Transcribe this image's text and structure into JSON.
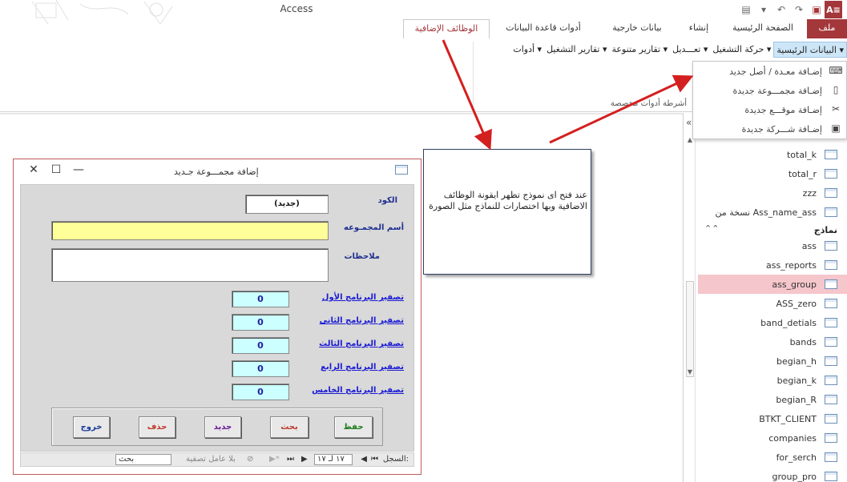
{
  "app": {
    "title": "Access"
  },
  "ribbon_tabs": {
    "file": "ملف",
    "home": "الصفحة الرئيسية",
    "create": "إنشاء",
    "external": "بيانات خارجية",
    "db_tools": "أدوات قاعدة البيانات",
    "addins": "الوظائف الإضافية"
  },
  "menubar": {
    "items": [
      "البيانات الرئيسية",
      "حركة التشغيل",
      "تعـــديل",
      "تقارير متنوعة",
      "تقارير التشغيل",
      "أدوات"
    ],
    "group_label": "أشرطة أدوات مخصصة"
  },
  "dropdown": {
    "items": [
      "إضـافة معـدة / أصل جديد",
      "إضـافة مجمـــوعة جديدة",
      "إضـافة موقـــع جديدة",
      "إضـافة شـــركة جديدة"
    ]
  },
  "callout": {
    "text": "عند فتح اى نموذج تظهر ايقونة الوظائف الاضافية وبها اختصارات للنماذج مثل الصورة"
  },
  "nav": {
    "top_items": [
      "total_k",
      "total_r",
      "zzz",
      "نسخة من Ass_name_ass"
    ],
    "section_forms": "نماذج",
    "form_items": [
      "ass",
      "ass_reports",
      "ass_group",
      "ASS_zero",
      "band_detials",
      "bands",
      "begian_h",
      "begian_k",
      "begian_R",
      "BTKT_CLIENT",
      "companies",
      "for_serch",
      "group_pro"
    ],
    "selected": "ass_group"
  },
  "form": {
    "title": "إضافة مجمـــوعة جـديد",
    "code_label": "الكود",
    "code_value": "(جديد)",
    "name_label": "أسم المجمـوعه",
    "notes_label": "ملاحظات",
    "reset_links": [
      "تصفير البرنامج الأول",
      "تصفير البرنامج الثانى",
      "تصفير البرنامج الثالث",
      "تصفير البرنامج الرابع",
      "تصفير البرنامج الخامس"
    ],
    "reset_values": [
      "0",
      "0",
      "0",
      "0",
      "0"
    ],
    "buttons": {
      "save": "حفظ",
      "search": "بحث",
      "new": "جديد",
      "delete": "حذف",
      "exit": "خروج"
    },
    "button_colors": {
      "save": "#1a7a1a",
      "search": "#c0392b",
      "new": "#6a1b9a",
      "delete": "#c0392b",
      "exit": "#1a3a9a"
    },
    "record_bar": {
      "label": "السجل:",
      "position": "١٧ لـ ١٧",
      "no_filter": "بلا عامل تصفية",
      "search": "بحث"
    }
  }
}
